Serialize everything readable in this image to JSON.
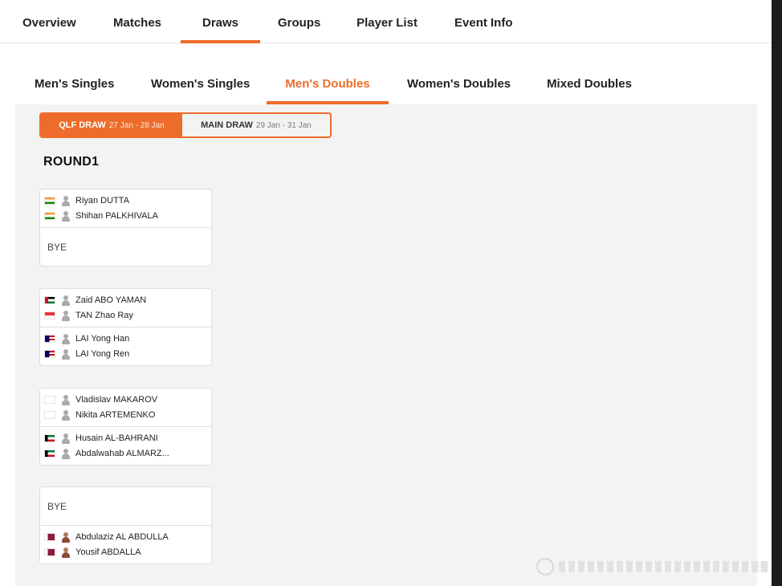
{
  "top_nav": {
    "tabs": [
      {
        "label": "Overview",
        "active": false
      },
      {
        "label": "Matches",
        "active": false
      },
      {
        "label": "Draws",
        "active": true
      },
      {
        "label": "Groups",
        "active": false
      },
      {
        "label": "Player List",
        "active": false
      },
      {
        "label": "Event Info",
        "active": false
      }
    ]
  },
  "event_tabs": {
    "tabs": [
      {
        "label": "Men's Singles",
        "active": false
      },
      {
        "label": "Women's Singles",
        "active": false
      },
      {
        "label": "Men's Doubles",
        "active": true
      },
      {
        "label": "Women's Doubles",
        "active": false
      },
      {
        "label": "Mixed Doubles",
        "active": false
      }
    ]
  },
  "draw_toggle": {
    "qlf": {
      "label": "QLF DRAW",
      "dates": "27 Jan - 28 Jan",
      "selected": true
    },
    "main": {
      "label": "MAIN DRAW",
      "dates": "29 Jan - 31 Jan",
      "selected": false
    }
  },
  "round": {
    "title": "ROUND1"
  },
  "matches": [
    {
      "a": {
        "bye": false,
        "players": [
          {
            "name": "Riyan DUTTA",
            "flag": "india"
          },
          {
            "name": "Shihan PALKHIVALA",
            "flag": "india"
          }
        ]
      },
      "b": {
        "bye": true,
        "bye_label": "BYE"
      }
    },
    {
      "a": {
        "bye": false,
        "players": [
          {
            "name": "Zaid ABO YAMAN",
            "flag": "jordan"
          },
          {
            "name": "TAN Zhao Ray",
            "flag": "singapore"
          }
        ]
      },
      "b": {
        "bye": false,
        "players": [
          {
            "name": "LAI Yong Han",
            "flag": "malaysia"
          },
          {
            "name": "LAI Yong Ren",
            "flag": "malaysia"
          }
        ]
      }
    },
    {
      "a": {
        "bye": false,
        "players": [
          {
            "name": "Vladislav MAKAROV",
            "flag": "blank"
          },
          {
            "name": "Nikita ARTEMENKO",
            "flag": "blank"
          }
        ]
      },
      "b": {
        "bye": false,
        "players": [
          {
            "name": "Husain AL-BAHRANI",
            "flag": "kuwait"
          },
          {
            "name": "Abdalwahab ALMARZ...",
            "flag": "kuwait"
          }
        ]
      }
    },
    {
      "a": {
        "bye": true,
        "bye_label": "BYE"
      },
      "b": {
        "bye": false,
        "players": [
          {
            "name": "Abdulaziz AL ABDULLA",
            "flag": "qatar",
            "avatar": "photo"
          },
          {
            "name": "Yousif ABDALLA",
            "flag": "qatar",
            "avatar": "photo"
          }
        ]
      }
    }
  ],
  "colors": {
    "accent": "#ee6c2b",
    "panel_bg": "#f3f3f3"
  }
}
